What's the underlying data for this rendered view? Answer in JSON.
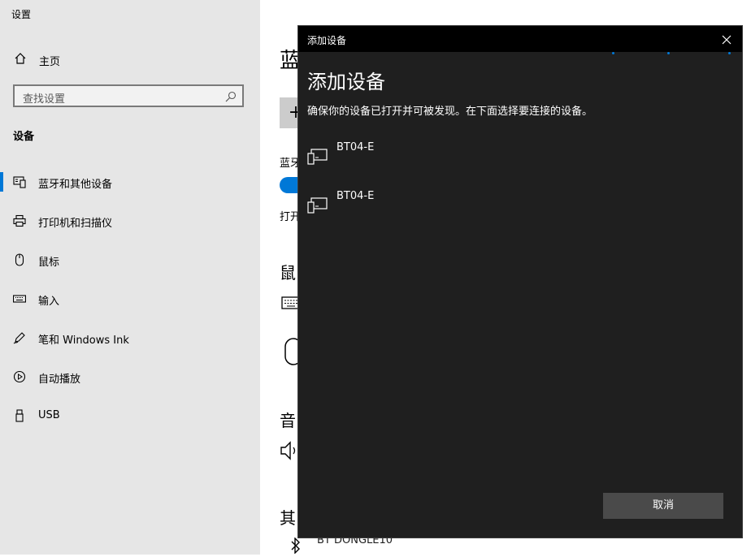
{
  "window": {
    "title": "设置"
  },
  "sidebar": {
    "home_label": "主页",
    "search_placeholder": "查找设置",
    "section_title": "设备",
    "items": [
      {
        "label": "蓝牙和其他设备",
        "icon": "bluetooth-devices-icon",
        "selected": true
      },
      {
        "label": "打印机和扫描仪",
        "icon": "printer-icon"
      },
      {
        "label": "鼠标",
        "icon": "mouse-icon"
      },
      {
        "label": "输入",
        "icon": "keyboard-icon"
      },
      {
        "label": "笔和 Windows Ink",
        "icon": "pen-icon"
      },
      {
        "label": "自动播放",
        "icon": "autoplay-icon"
      },
      {
        "label": "USB",
        "icon": "usb-icon"
      }
    ]
  },
  "main": {
    "page_title_partial": "蓝",
    "add_button_glyph": "+",
    "bluetooth_label_partial": "蓝牙",
    "on_text_partial": "打开",
    "heading_mouse_partial": "鼠",
    "heading_audio_partial": "音",
    "heading_other_partial": "其",
    "dongle_partial": "BT DONGLE10"
  },
  "dialog": {
    "title": "添加设备",
    "heading": "添加设备",
    "description": "确保你的设备已打开并可被发现。在下面选择要连接的设备。",
    "devices": [
      {
        "name": "BT04-E",
        "icon": "device-icon"
      },
      {
        "name": "BT04-E",
        "icon": "device-icon"
      }
    ],
    "cancel_label": "取消"
  },
  "colors": {
    "accent": "#0078d7",
    "dialog_bg": "#1f1f1f",
    "titlebar_bg": "#000000",
    "sidebar_bg": "#e6e6e6",
    "cancel_bg": "#4a4a4a"
  }
}
